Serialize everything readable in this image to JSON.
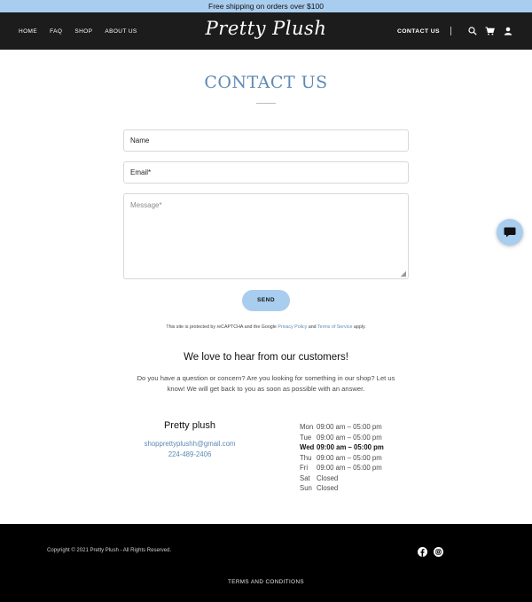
{
  "promo": {
    "text": "Free shipping on orders over $100"
  },
  "nav": {
    "logo": "Pretty Plush",
    "items": [
      {
        "label": "HOME"
      },
      {
        "label": "FAQ"
      },
      {
        "label": "SHOP"
      },
      {
        "label": "ABOUT US"
      }
    ],
    "active_label": "CONTACT US",
    "icons": [
      "search-icon",
      "cart-icon",
      "user-icon"
    ]
  },
  "main": {
    "title": "CONTACT US",
    "form": {
      "name_placeholder": "Name",
      "email_placeholder": "Email*",
      "message_placeholder": "Message*",
      "send_label": "SEND"
    },
    "recaptcha": {
      "prefix": "This site is protected by reCAPTCHA and the Google ",
      "privacy_link": "Privacy Policy",
      "middle": " and ",
      "terms_link": "Terms of Service",
      "suffix": " apply."
    },
    "heading": "We love to hear from our customers!",
    "question": "Do you have a question or concern? Are you looking for something in our shop? Let us know! We will get back to you as soon as possible with an answer.",
    "business": {
      "name": "Pretty plush",
      "email": "shopprettyplushh@gmail.com",
      "phone": "224-489-2406"
    },
    "hours": [
      {
        "day": "Mon",
        "time": "09:00 am – 05:00 pm",
        "today": false
      },
      {
        "day": "Tue",
        "time": "09:00 am – 05:00 pm",
        "today": false
      },
      {
        "day": "Wed",
        "time": "09:00 am – 05:00 pm",
        "today": true
      },
      {
        "day": "Thu",
        "time": "09:00 am – 05:00 pm",
        "today": false
      },
      {
        "day": "Fri",
        "time": "09:00 am – 05:00 pm",
        "today": false
      },
      {
        "day": "Sat",
        "time": "Closed",
        "today": false
      },
      {
        "day": "Sun",
        "time": "Closed",
        "today": false
      }
    ]
  },
  "footer": {
    "copyright": "Copyright © 2021 Pretty Plush - All Rights Reserved.",
    "terms": "TERMS AND CONDITIONS",
    "social": [
      "facebook-icon",
      "instagram-icon"
    ]
  },
  "colors": {
    "accent": "#a9cdee",
    "title": "#5e89b5",
    "nav_bg": "#1c1c1c",
    "footer_bg": "#000000"
  }
}
